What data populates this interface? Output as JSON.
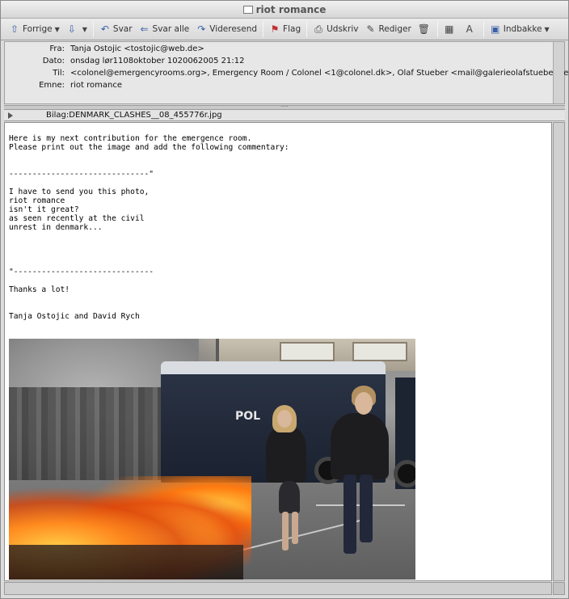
{
  "window": {
    "title": "riot romance"
  },
  "toolbar": {
    "buttons": [
      {
        "label": "Forrige",
        "icon": "arrow-up-icon",
        "dropdown": true
      },
      {
        "label": "",
        "icon": "arrow-down-icon",
        "dropdown": true
      },
      {
        "label": "Svar",
        "icon": "reply-icon"
      },
      {
        "label": "Svar alle",
        "icon": "reply-all-icon"
      },
      {
        "label": "Videresend",
        "icon": "forward-icon"
      },
      {
        "label": "Flag",
        "icon": "flag-icon"
      },
      {
        "label": "Udskriv",
        "icon": "print-icon"
      },
      {
        "label": "Rediger",
        "icon": "edit-icon"
      },
      {
        "label": "",
        "icon": "trash-icon"
      },
      {
        "label": "",
        "icon": "grid-icon"
      },
      {
        "label": "",
        "icon": "font-size-icon"
      },
      {
        "label": "Indbakke",
        "icon": "inbox-icon",
        "dropdown": true
      }
    ]
  },
  "headers": {
    "from_label": "Fra:",
    "from_value": "Tanja Ostojic <tostojic@web.de>",
    "date_label": "Dato:",
    "date_value": "onsdag lør1108oktober 1020062005 21:12",
    "to_label": "Til:",
    "to_value": "<colonel@emergencyrooms.org>, Emergency Room / Colonel <1@colonel.dk>, Olaf Stueber <mail@galerieolafstueber.de>",
    "subject_label": "Emne:",
    "subject_value": "riot romance"
  },
  "attachment": {
    "label": "Bilag:DENMARK_CLASHES__08_455776r.jpg"
  },
  "body": {
    "text": "Here is my next contribution for the emergence room.\nPlease print out the image and add the following commentary:\n\n\n------------------------------\"\n\nI have to send you this photo,\nriot romance\nisn't it great?\nas seen recently at the civil\nunrest in denmark...\n\n\n\n\n\"------------------------------\n\nThanks a lot!\n\n\nTanja Ostojic and David Rych"
  },
  "photo": {
    "van_text": "POL"
  }
}
